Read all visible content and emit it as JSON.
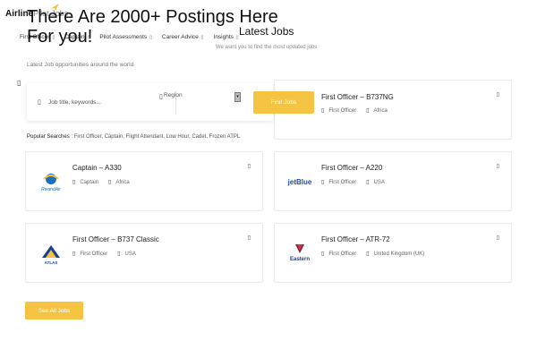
{
  "brand": {
    "name": "Airline",
    "name_rest": "Pilot Jobs"
  },
  "nav": {
    "items": [
      {
        "label": "First Officer",
        "caret": "▯"
      },
      {
        "label": "Captain",
        "caret": "▯"
      },
      {
        "label": "Pilot Assessments",
        "caret": "▯"
      },
      {
        "label": "Career Advice",
        "caret": "▯"
      },
      {
        "label": "Insights",
        "caret": "▯"
      }
    ]
  },
  "hero": {
    "title_line1": "There Are 2000+ Postings Here",
    "title_line2": "For you!",
    "subtitle": "Latest Job opportunities around the world"
  },
  "search": {
    "placeholder": "Job title, keywords...",
    "region_label": "Region",
    "button_label": "Find Jobs"
  },
  "popular": {
    "label": "Popular Searches :",
    "items": "First Officer, Captain, Flight Attendant, Low Hour, Cadet, Frozen ATPL"
  },
  "latest": {
    "title": "Latest Jobs",
    "subtitle": "We want you to find the most updated jobs"
  },
  "icons": {
    "glyph": "▯"
  },
  "jobs": [
    {
      "title": "First Officer – B737NG",
      "role": "First Officer",
      "location": "Africa",
      "logo": "none"
    },
    {
      "title": "Captain – A330",
      "role": "Captain",
      "location": "Africa",
      "logo": "RwandAir"
    },
    {
      "title": "First Officer – A220",
      "role": "First Officer",
      "location": "USA",
      "logo": "jetBlue"
    },
    {
      "title": "First Officer – B737 Classic",
      "role": "First Officer",
      "location": "USA",
      "logo": "ATLAS"
    },
    {
      "title": "First Officer – ATR-72",
      "role": "First Officer",
      "location": "United Kingdom (UK)",
      "logo": "Eastern"
    }
  ],
  "logos": {
    "rwandair": {
      "text": "RwandAir"
    },
    "jetblue": {
      "text": "jetBlue"
    },
    "atlas": {
      "text": "ATLAS"
    },
    "eastern": {
      "text": "Eastern"
    }
  },
  "see_all": {
    "label": "See All Jobs"
  },
  "colors": {
    "accent": "#f3c341",
    "card_border": "#ececec"
  }
}
